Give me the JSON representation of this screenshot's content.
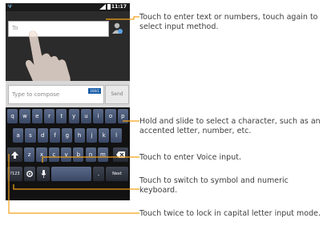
{
  "phone": {
    "status_time": "11:17",
    "to_placeholder": "To",
    "compose_placeholder": "Type to compose",
    "compose_badge": "160/1",
    "send_label": "Send"
  },
  "keyboard": {
    "row1": [
      "q",
      "w",
      "e",
      "r",
      "t",
      "y",
      "u",
      "i",
      "o",
      "p"
    ],
    "row2": [
      "a",
      "s",
      "d",
      "f",
      "g",
      "h",
      "j",
      "k",
      "l"
    ],
    "row3": [
      "z",
      "x",
      "c",
      "v",
      "b",
      "n",
      "m"
    ],
    "symbols_key": "?123",
    "period_key": ".",
    "next_key": "Next",
    "shift_icon": "shift-arrow-icon",
    "backspace_icon": "backspace-icon",
    "mic_icon": "microphone-icon",
    "settings_icon": "settings-icon"
  },
  "callouts": [
    {
      "text": "Touch to enter text or numbers, touch again to select input method."
    },
    {
      "text": "Hold and slide to select a character, such as an accented letter, number, etc."
    },
    {
      "text": "Touch to enter Voice input."
    },
    {
      "text": "Touch to switch to symbol and numeric keyboard."
    },
    {
      "text": "Touch twice to lock in capital letter input mode."
    }
  ],
  "colors": {
    "leader_line": "#f5a21a",
    "key_top": "#5a6a88",
    "key_bottom": "#3a4866",
    "text": "#3d3d3d"
  }
}
